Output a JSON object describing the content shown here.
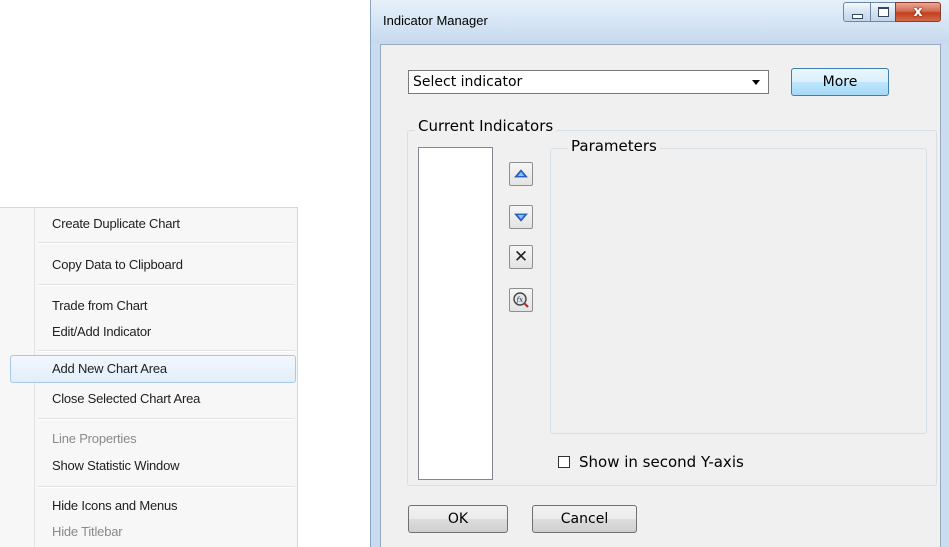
{
  "context_menu": {
    "items": [
      {
        "label": "Create Duplicate Chart"
      },
      {
        "label": "Copy Data to Clipboard"
      },
      {
        "label": "Trade from Chart"
      },
      {
        "label": "Edit/Add Indicator"
      },
      {
        "label": "Add New Chart Area"
      },
      {
        "label": "Close Selected Chart Area"
      },
      {
        "label": "Line Properties"
      },
      {
        "label": "Show Statistic Window"
      },
      {
        "label": "Hide Icons and Menus"
      },
      {
        "label": "Hide Titlebar"
      }
    ]
  },
  "dialog": {
    "title": "Indicator Manager",
    "close_glyph": "x",
    "indicator_select": {
      "value": "Select indicator"
    },
    "more_label": "More",
    "current_indicators_label": "Current Indicators",
    "parameters_label": "Parameters",
    "second_axis_label": "Show in second Y-axis",
    "second_axis_checked": false,
    "ok_label": "OK",
    "cancel_label": "Cancel",
    "remove_glyph": "✕"
  },
  "colors": {
    "highlight_border": "#a8c7ea",
    "close_button": "#c2401f",
    "arrow_blue": "#2f6fd6"
  }
}
